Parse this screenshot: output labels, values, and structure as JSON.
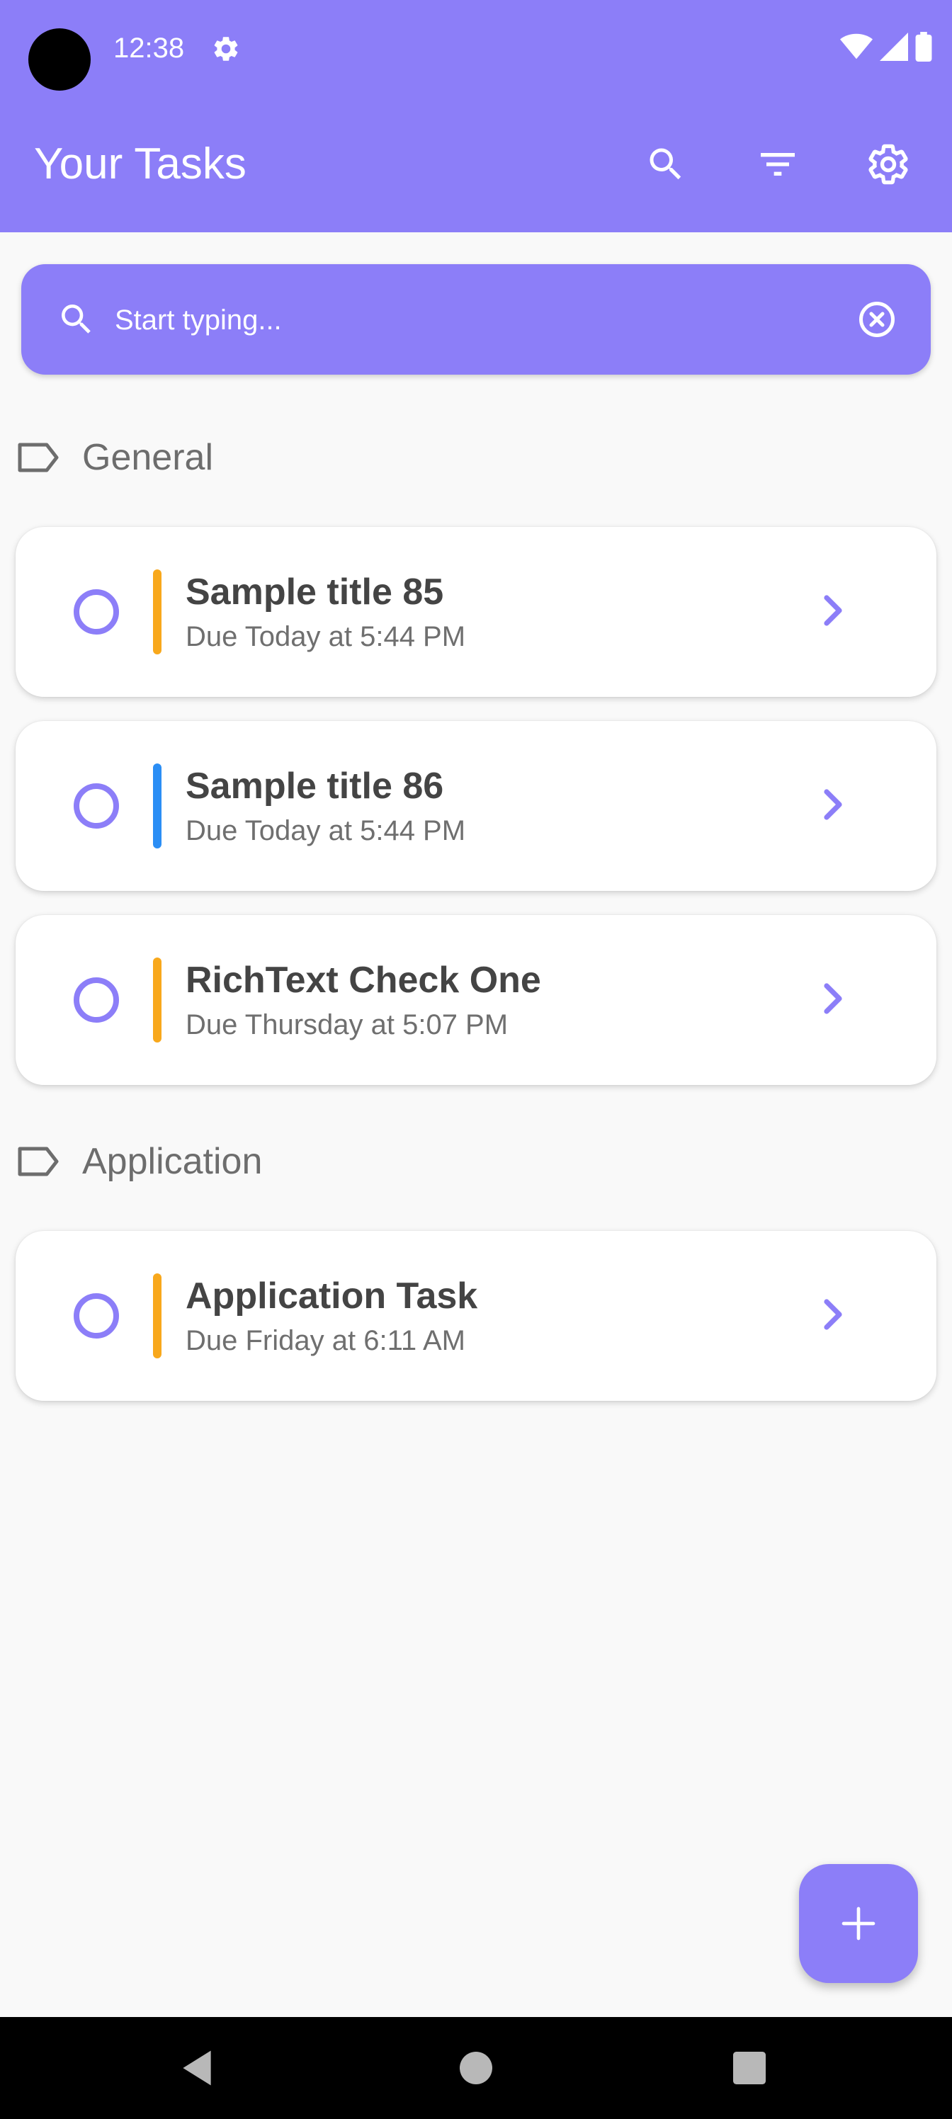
{
  "status_bar": {
    "time": "12:38"
  },
  "app_bar": {
    "title": "Your Tasks",
    "actions": [
      "search-icon",
      "filter-icon",
      "settings-icon"
    ]
  },
  "search": {
    "placeholder": "Start typing..."
  },
  "sections": [
    {
      "label": "General",
      "tasks": [
        {
          "title": "Sample title 85",
          "due": "Due Today at 5:44 PM",
          "priority_color": "#f8a81c"
        },
        {
          "title": "Sample title 86",
          "due": "Due Today at 5:44 PM",
          "priority_color": "#2b8ef5"
        },
        {
          "title": "RichText Check One",
          "due": "Due Thursday at 5:07 PM",
          "priority_color": "#f8a81c"
        }
      ]
    },
    {
      "label": "Application",
      "tasks": [
        {
          "title": "Application Task",
          "due": "Due Friday at 6:11 AM",
          "priority_color": "#f8a81c"
        }
      ]
    }
  ],
  "colors": {
    "accent": "#8c7ef8",
    "background": "#f9f9f9",
    "card": "#ffffff"
  }
}
